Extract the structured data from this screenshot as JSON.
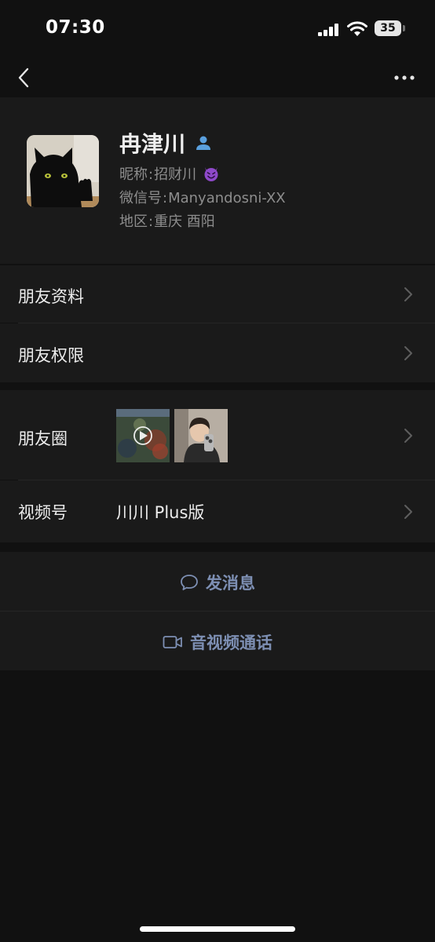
{
  "status_bar": {
    "time": "07:30",
    "battery_level": "35"
  },
  "nav": {
    "back_icon": "chevron-left-icon",
    "more_icon": "ellipsis-icon"
  },
  "profile": {
    "name": "冉津川",
    "nickname_label": "昵称",
    "nickname_value": "招财川",
    "wechat_id_label": "微信号",
    "wechat_id_value": "Manyandosni-XX",
    "region_label": "地区",
    "region_value": "重庆 酉阳"
  },
  "menu": {
    "friend_profile": "朋友资料",
    "friend_permissions": "朋友权限",
    "moments": "朋友圈",
    "channels": "视频号",
    "channels_value": "川川 Plus版"
  },
  "actions": {
    "send_message": "发消息",
    "video_call": "音视频通话"
  },
  "colors": {
    "background": "#111111",
    "panel": "#1a1a1a",
    "action_text": "#7d8fb3",
    "secondary_text": "#8d8d8d",
    "contact_badge": "#5aa0de"
  }
}
